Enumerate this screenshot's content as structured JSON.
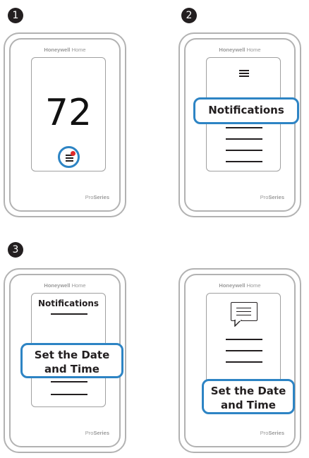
{
  "steps": [
    "1",
    "2",
    "3"
  ],
  "brand": {
    "name_bold": "Honeywell",
    "name_light": " Home"
  },
  "series": {
    "light": "Pro",
    "bold": "Series"
  },
  "panel1": {
    "temperature": "72"
  },
  "panel2": {
    "highlight": "Notifications"
  },
  "panel3": {
    "title": "Notifications",
    "highlight_line1": "Set the Date",
    "highlight_line2": "and Time"
  },
  "panel4": {
    "highlight_line1": "Set the Date",
    "highlight_line2": "and Time"
  },
  "colors": {
    "highlight": "#2d84c4",
    "alert_dot": "#e02a2a",
    "bezel": "#b2b2b2"
  },
  "icons": [
    "menu-icon",
    "notification-dot-icon",
    "message-bubble-icon"
  ]
}
